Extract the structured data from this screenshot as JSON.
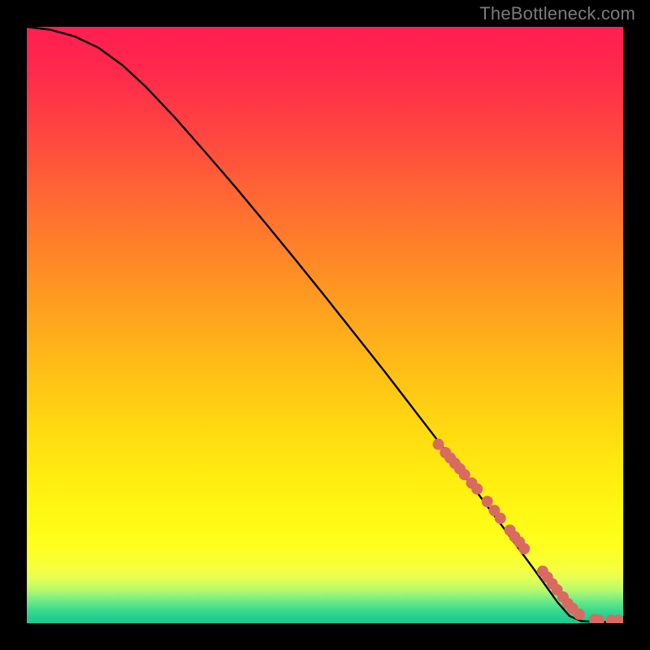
{
  "watermark": "TheBottleneck.com",
  "chart_data": {
    "type": "line",
    "title": "",
    "xlabel": "",
    "ylabel": "",
    "x_range": [
      0,
      100
    ],
    "y_range": [
      0,
      100
    ],
    "curve": {
      "x": [
        0,
        4,
        8,
        12,
        16,
        20,
        25,
        30,
        35,
        40,
        45,
        50,
        55,
        60,
        65,
        70,
        75,
        80,
        83,
        85,
        87,
        89,
        91,
        93,
        95,
        97,
        100
      ],
      "y": [
        100,
        99.5,
        98.4,
        96.5,
        93.6,
        89.9,
        84.6,
        78.9,
        73.1,
        67.1,
        61.0,
        54.8,
        48.5,
        42.2,
        35.7,
        29.2,
        22.6,
        15.9,
        11.8,
        9.1,
        6.3,
        3.5,
        1.2,
        0.35,
        0.25,
        0.2,
        0.2
      ]
    },
    "scatter_points": {
      "x": [
        69.0,
        70.2,
        71.0,
        71.8,
        72.6,
        73.4,
        74.6,
        75.5,
        77.2,
        78.4,
        79.4,
        81.0,
        81.8,
        82.6,
        83.4,
        86.5,
        87.3,
        88.1,
        88.9,
        89.9,
        90.7,
        91.5,
        92.6,
        95.2,
        95.9,
        98.0,
        99.2
      ],
      "y": [
        30.0,
        28.6,
        27.7,
        26.8,
        25.9,
        24.9,
        23.5,
        22.5,
        20.4,
        18.9,
        17.6,
        15.6,
        14.5,
        13.6,
        12.5,
        8.7,
        7.7,
        6.6,
        5.6,
        4.4,
        3.3,
        2.5,
        1.5,
        0.6,
        0.5,
        0.5,
        0.5
      ],
      "color": "#d96a62",
      "radius": 7
    },
    "background_gradient": {
      "stops": [
        {
          "offset": 0.0,
          "color": "#ff1e52"
        },
        {
          "offset": 0.08,
          "color": "#ff2a4b"
        },
        {
          "offset": 0.18,
          "color": "#ff4640"
        },
        {
          "offset": 0.28,
          "color": "#ff6634"
        },
        {
          "offset": 0.38,
          "color": "#ff8428"
        },
        {
          "offset": 0.48,
          "color": "#ffa21e"
        },
        {
          "offset": 0.58,
          "color": "#ffc016"
        },
        {
          "offset": 0.68,
          "color": "#ffdb10"
        },
        {
          "offset": 0.76,
          "color": "#ffee10"
        },
        {
          "offset": 0.82,
          "color": "#fff814"
        },
        {
          "offset": 0.872,
          "color": "#ffff1e"
        },
        {
          "offset": 0.905,
          "color": "#f7ff3c"
        },
        {
          "offset": 0.925,
          "color": "#e4ff55"
        },
        {
          "offset": 0.945,
          "color": "#b4f96e"
        },
        {
          "offset": 0.962,
          "color": "#70eb85"
        },
        {
          "offset": 0.978,
          "color": "#3cda90"
        },
        {
          "offset": 0.99,
          "color": "#24cf92"
        },
        {
          "offset": 1.0,
          "color": "#1cc98e"
        }
      ]
    }
  }
}
